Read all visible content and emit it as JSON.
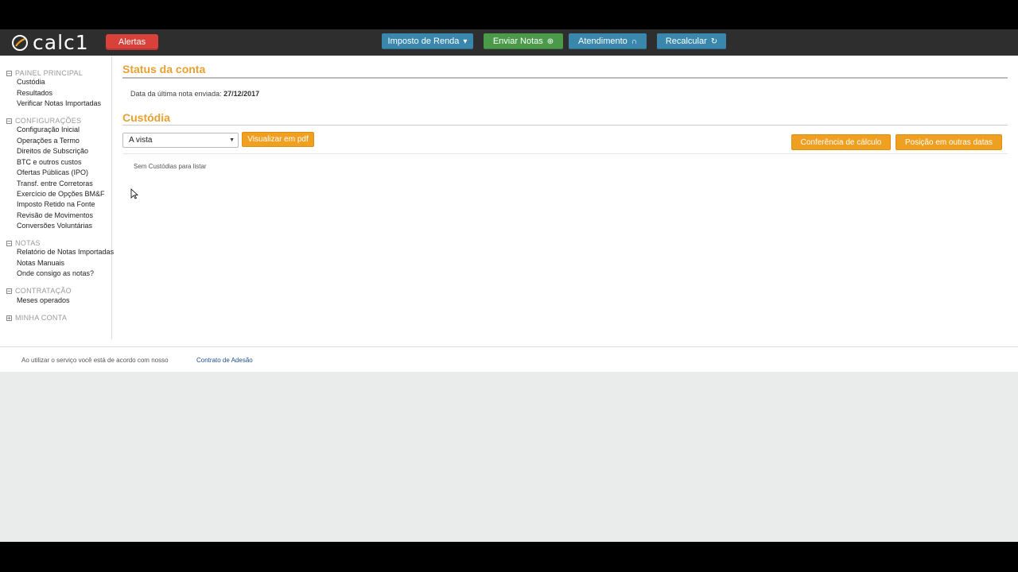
{
  "brand": {
    "logo_text": "calc1"
  },
  "topbar": {
    "alert_label": "Alertas",
    "nav": [
      {
        "label": "Imposto de Renda",
        "icon": "caret-down-icon"
      },
      {
        "label": "Enviar Notas",
        "icon": "arrow-circle-icon"
      },
      {
        "label": "Atendimento",
        "icon": "headset-icon"
      },
      {
        "label": "Recalcular",
        "icon": "refresh-icon"
      }
    ]
  },
  "sidebar": {
    "sections": [
      {
        "title": "PAINEL PRINCIPAL",
        "toggle": "−",
        "items": [
          "Custódia",
          "Resultados",
          "Verificar Notas Importadas"
        ]
      },
      {
        "title": "CONFIGURAÇÕES",
        "toggle": "−",
        "items": [
          "Configuração Inicial",
          "Operações a Termo",
          "Direitos de Subscrição",
          "BTC e outros custos",
          "Ofertas Públicas (IPO)",
          "Transf. entre Corretoras",
          "Exercício de Opções BM&F",
          "Imposto Retido na Fonte",
          "Revisão de Movimentos",
          "Conversões Voluntárias"
        ]
      },
      {
        "title": "NOTAS",
        "toggle": "−",
        "items": [
          "Relatório de Notas Importadas",
          "Notas Manuais",
          "Onde consigo as notas?"
        ]
      },
      {
        "title": "CONTRATAÇÃO",
        "toggle": "−",
        "items": [
          "Meses operados"
        ]
      },
      {
        "title": "MINHA CONTA",
        "toggle": "+",
        "items": []
      }
    ]
  },
  "main": {
    "status_title": "Status da conta",
    "status_label": "Data da última nota enviada:",
    "status_date": "27/12/2017",
    "custodia_title": "Custódia",
    "select_value": "A vista",
    "pdf_button": "Visualizar em pdf",
    "conf_button": "Conferência de cálculo",
    "pos_button": "Posição em outras datas",
    "empty_text": "Sem Custódias para listar"
  },
  "footer": {
    "text": "Ao utilizar o serviço você está de acordo com nosso",
    "link": "Contrato de Adesão"
  },
  "colors": {
    "accent": "#e8a030",
    "topbar": "#2e2e2e",
    "alert": "#d9413a",
    "nav_blue": "#3a87ad",
    "nav_green": "#4a9a4a",
    "orange_button": "#f0a020"
  }
}
